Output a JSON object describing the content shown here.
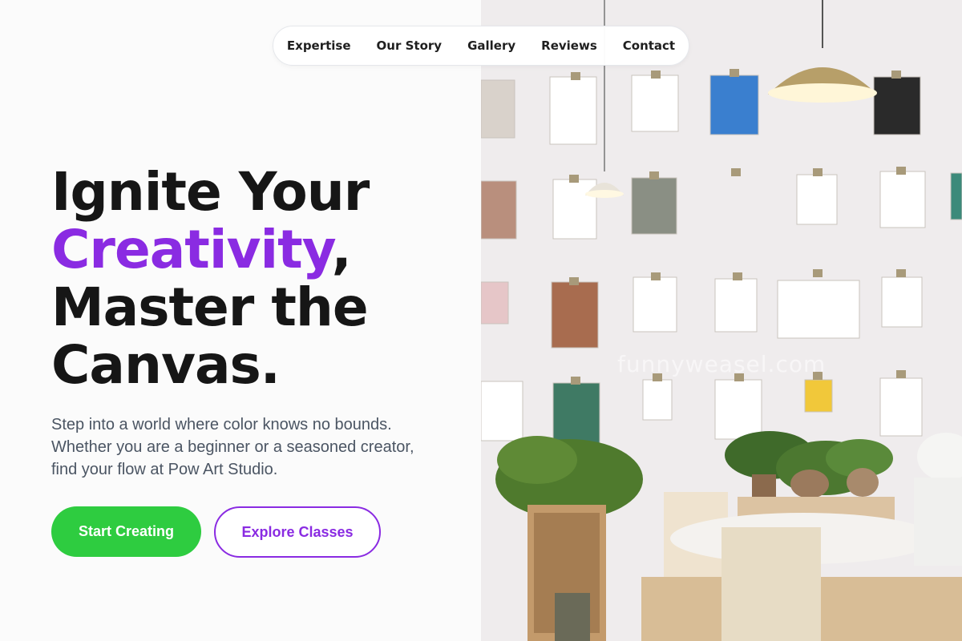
{
  "nav": {
    "items": [
      "Expertise",
      "Our Story",
      "Gallery",
      "Reviews",
      "Contact"
    ]
  },
  "hero": {
    "title_line1": "Ignite Your",
    "title_accent": "Creativity",
    "title_comma": ",",
    "title_line3": "Master the",
    "title_line4": "Canvas.",
    "description": "Step into a world where color knows no bounds. Whether you are a beginner or a seasoned creator, find your flow at Pow Art Studio.",
    "primary_cta": "Start Creating",
    "secondary_cta": "Explore Classes"
  },
  "photo": {
    "subject": "art-studio-wall-photo",
    "watermark": "funnyweasel.com"
  },
  "colors": {
    "accent_purple": "#8a2be2",
    "cta_green": "#2ecc40",
    "heading": "#161616",
    "body_text": "#4b5563"
  }
}
